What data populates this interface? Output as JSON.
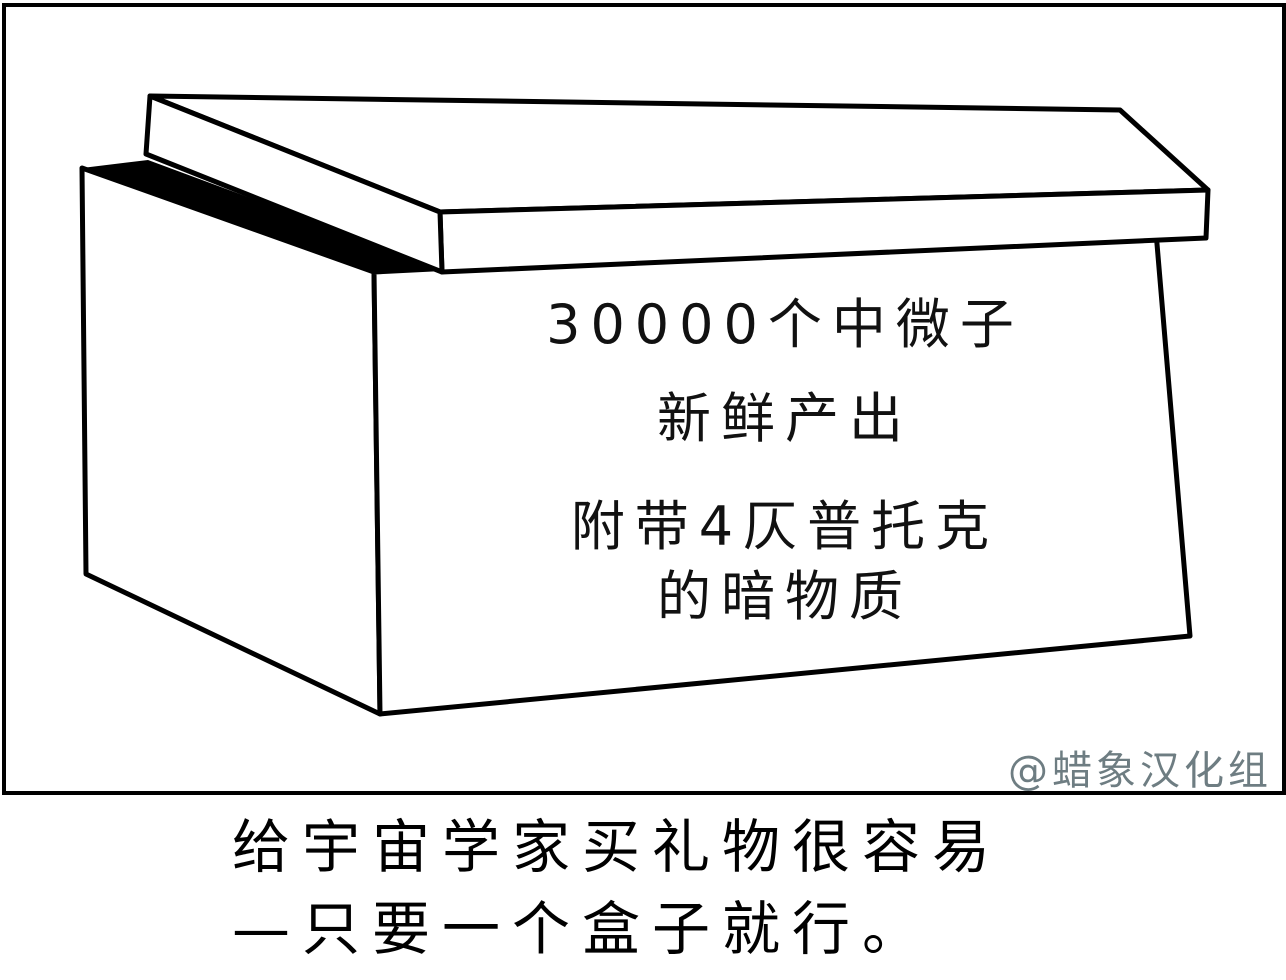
{
  "comic": {
    "box_label": {
      "line1": "30000个中微子",
      "line2": "新鲜产出",
      "line3": "附带4仄普托克",
      "line4": "的暗物质"
    },
    "watermark": "@蜡象汉化组",
    "caption": {
      "line1": "给宇宙学家买礼物很容易",
      "line2": "—只要一个盒子就行。"
    }
  }
}
